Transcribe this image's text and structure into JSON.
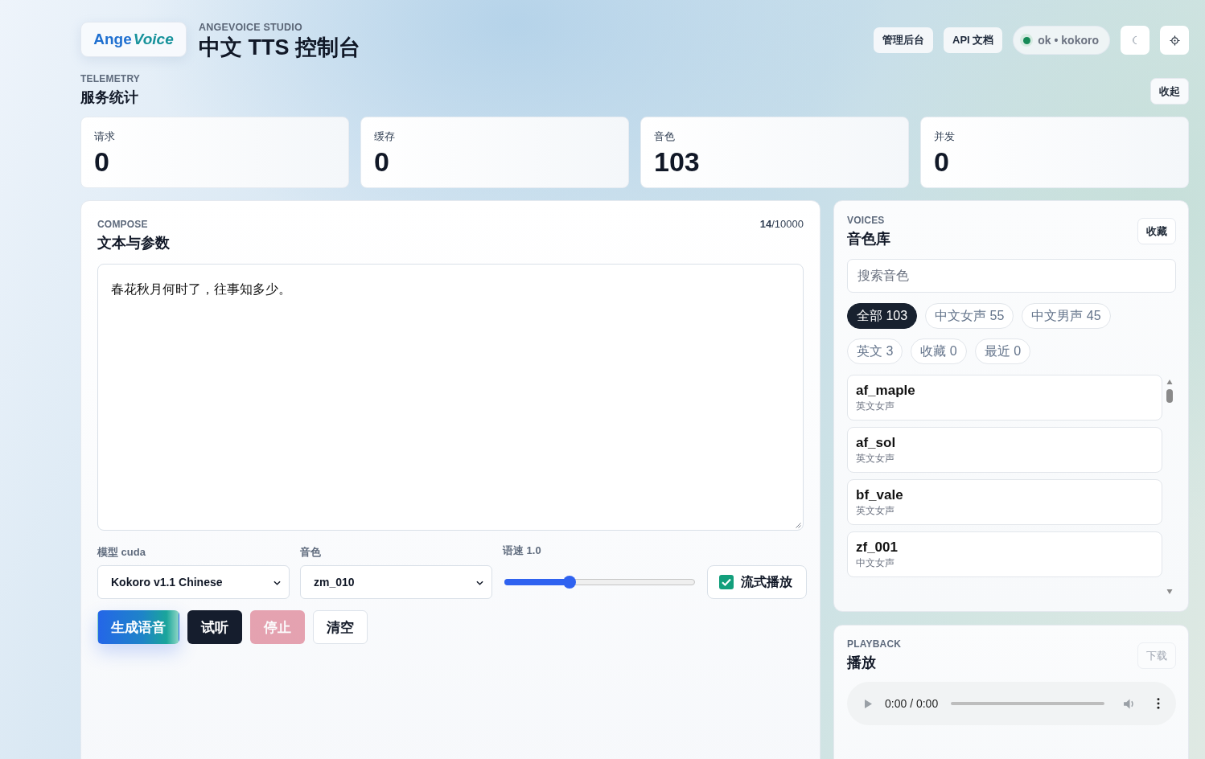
{
  "header": {
    "logo": {
      "first": "Ange",
      "second": "Voice"
    },
    "eyebrow": "ANGEVOICE STUDIO",
    "title": "中文 TTS 控制台",
    "links": [
      "管理后台",
      "API 文档"
    ],
    "status": {
      "text": "ok • kokoro",
      "online": true
    }
  },
  "telemetry": {
    "eyebrow": "TELEMETRY",
    "title": "服务统计",
    "toggle": "收起",
    "stats": [
      {
        "label": "请求",
        "value": "0"
      },
      {
        "label": "缓存",
        "value": "0"
      },
      {
        "label": "音色",
        "value": "103"
      },
      {
        "label": "并发",
        "value": "0"
      }
    ]
  },
  "compose": {
    "eyebrow": "COMPOSE",
    "title": "文本与参数",
    "count": "**14**/10000",
    "text": "春花秋月何时了，往事知多少。",
    "model": {
      "label": "模型 cuda",
      "value": "Kokoro v1.1 Chinese"
    },
    "voice": {
      "label": "音色",
      "value": "zm_010"
    },
    "speed": {
      "label": "语速 1.0",
      "level": 0.34
    },
    "streaming": {
      "label": "流式播放",
      "checked": true
    },
    "buttons": [
      {
        "kind": "primary",
        "label": "生成语音",
        "disabled": false
      },
      {
        "kind": "dark",
        "label": "试听",
        "disabled": false
      },
      {
        "kind": "danger",
        "label": "停止",
        "disabled": true
      },
      {
        "kind": "plain",
        "label": "清空",
        "disabled": false
      }
    ]
  },
  "voices": {
    "eyebrow": "VOICES",
    "title": "音色库",
    "favorites": "收藏",
    "search": {
      "placeholder": "搜索音色"
    },
    "filters": [
      {
        "label": "全部 103",
        "selected": true
      },
      {
        "label": "中文女声 55",
        "selected": false
      },
      {
        "label": "中文男声 45",
        "selected": false
      },
      {
        "label": "英文 3",
        "selected": false
      },
      {
        "label": "收藏 0",
        "selected": false
      },
      {
        "label": "最近 0",
        "selected": false
      }
    ],
    "items": [
      {
        "name": "af_maple",
        "tag": "英文女声",
        "selected": false
      },
      {
        "name": "af_sol",
        "tag": "英文女声",
        "selected": false
      },
      {
        "name": "bf_vale",
        "tag": "英文女声",
        "selected": false
      },
      {
        "name": "zf_001",
        "tag": "中文女声",
        "selected": false
      }
    ]
  },
  "playback": {
    "eyebrow": "PLAYBACK",
    "title": "播放",
    "download": {
      "label": "下载",
      "disabled": true
    },
    "player": {
      "time": "0:00 / 0:00"
    }
  }
}
